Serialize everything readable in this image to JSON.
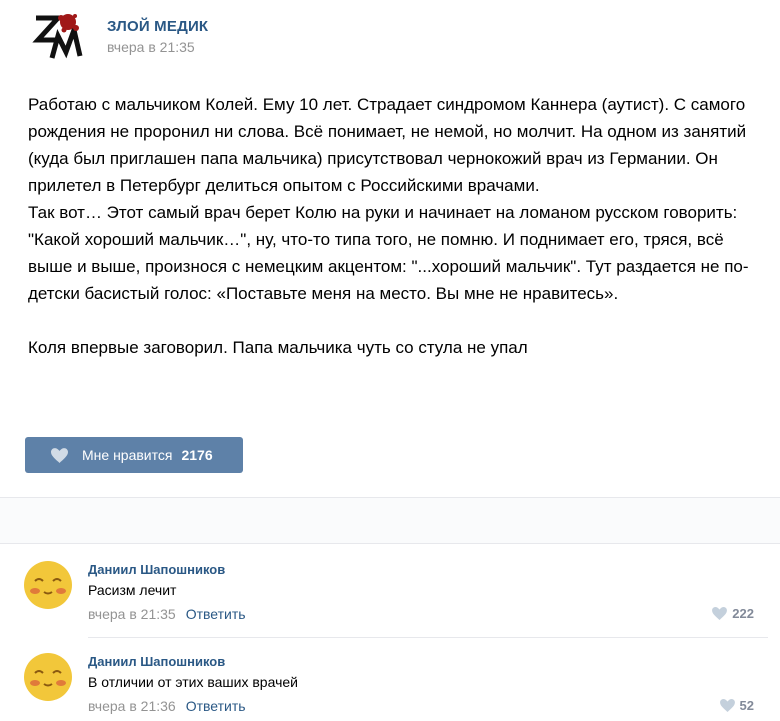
{
  "post": {
    "author": "ЗЛОЙ МЕДИК",
    "time": "вчера в 21:35",
    "paragraphs": [
      "Работаю с мальчиком Колей. Ему 10 лет. Страдает синдромом Каннера (аутист). С самого рождения не проронил ни слова. Всё понимает, не немой, но молчит. На одном из занятий (куда был приглашен папа мальчика) присутствовал чернокожий врач из Германии. Он прилетел в Петербург делиться опытом с Российскими врачами.",
      "Так вот… Этот самый врач берет Колю на руки и начинает на ломаном русском говорить: \"Какой хороший мальчик…\", ну, что-то типа того, не помню. И поднимает его, тряся, всё выше и выше, произнося с немецким акцентом: \"...хороший мальчик\". Тут раздается не по-детски басистый голос: «Поставьте меня на место. Вы мне не нравитесь».",
      "Коля впервые заговорил. Папа мальчика чуть со стула не упал"
    ],
    "like_label": "Мне нравится",
    "like_count": "2176"
  },
  "comments": [
    {
      "author": "Даниил Шапошников",
      "text": "Расизм лечит",
      "time": "вчера в 21:35",
      "reply_label": "Ответить",
      "likes": "222"
    },
    {
      "author": "Даниил Шапошников",
      "text": "В отличии от этих ваших врачей",
      "time": "вчера в 21:36",
      "reply_label": "Ответить",
      "likes": "52"
    }
  ],
  "colors": {
    "link": "#2a5885",
    "like_button": "#5e81a8",
    "meta": "#939393"
  },
  "icons": {
    "logo": "zm-logo-with-blood-splatter",
    "like": "heart-icon",
    "avatar": "smiley-face-avatar"
  }
}
